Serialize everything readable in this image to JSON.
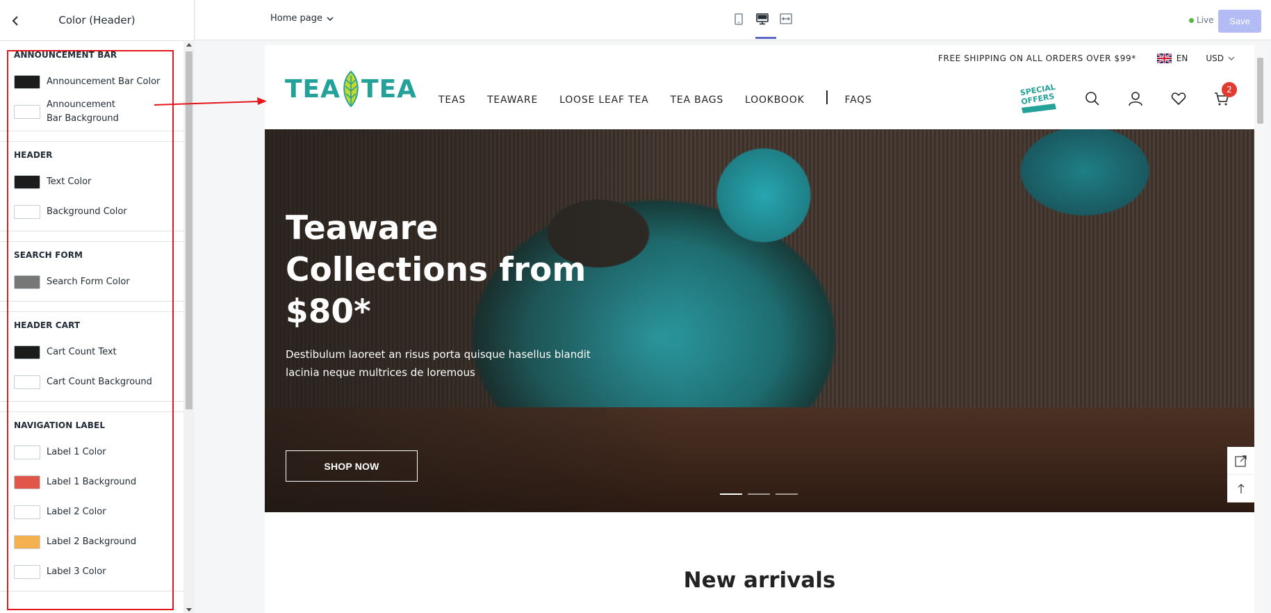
{
  "sidebar": {
    "title": "Color (Header)",
    "sections": [
      {
        "title": "ANNOUNCEMENT BAR",
        "items": [
          {
            "label": "Announcement Bar Color",
            "color": "#1c1c1c"
          },
          {
            "label": "Announcement Bar Background",
            "color": "#ffffff"
          }
        ]
      },
      {
        "title": "HEADER",
        "items": [
          {
            "label": "Text Color",
            "color": "#1c1c1c"
          },
          {
            "label": "Background Color",
            "color": "#ffffff"
          }
        ]
      },
      {
        "title": "SEARCH FORM",
        "items": [
          {
            "label": "Search Form Color",
            "color": "#777777"
          }
        ]
      },
      {
        "title": "HEADER CART",
        "items": [
          {
            "label": "Cart Count Text",
            "color": "#1c1c1c"
          },
          {
            "label": "Cart Count Background",
            "color": "#ffffff"
          }
        ]
      },
      {
        "title": "NAVIGATION LABEL",
        "items": [
          {
            "label": "Label 1 Color",
            "color": "#ffffff"
          },
          {
            "label": "Label 1 Background",
            "color": "#e0574a"
          },
          {
            "label": "Label 2 Color",
            "color": "#ffffff"
          },
          {
            "label": "Label 2 Background",
            "color": "#f5b04f"
          },
          {
            "label": "Label 3 Color",
            "color": "#ffffff"
          }
        ]
      }
    ]
  },
  "topbar": {
    "page_select": "Home page",
    "live_label": "Live",
    "save_label": "Save",
    "devices": [
      "mobile-icon",
      "desktop-icon",
      "fullwidth-icon"
    ],
    "active_device": "desktop-icon"
  },
  "store": {
    "announcement": "FREE SHIPPING ON ALL ORDERS OVER $99*",
    "language": "EN",
    "currency": "USD",
    "logo_text": "TEATEA",
    "logo_left": "TEA",
    "logo_right": "TEA",
    "nav": [
      "TEAS",
      "TEAWARE",
      "LOOSE LEAF TEA",
      "TEA BAGS",
      "LOOKBOOK",
      "FAQS"
    ],
    "special_offer": "SPECIAL OFFERS",
    "cart_count": "2",
    "hero": {
      "title": "Teaware Collections from $80*",
      "subtitle": "Destibulum laoreet an risus porta quisque hasellus blandit lacinia neque multrices de loremous",
      "button": "SHOP NOW",
      "slides": 3,
      "active_slide": 1
    },
    "section_title": "New arrivals"
  },
  "colors": {
    "accent": "#5c6ac4",
    "brand": "#24a29a",
    "highlight": "#e5161b",
    "badge": "#e03c31"
  }
}
